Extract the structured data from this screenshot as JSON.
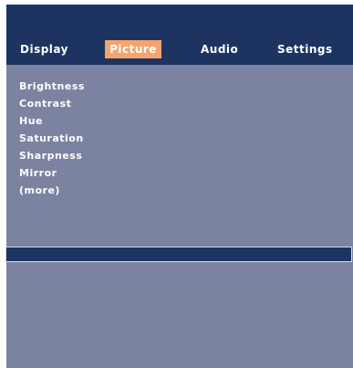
{
  "tabs": {
    "display": "Display",
    "picture": "Picture",
    "audio": "Audio",
    "settings": "Settings"
  },
  "selected_tab": "Picture",
  "picture_menu": {
    "items": [
      "Brightness",
      "Contrast",
      "Hue",
      "Saturation",
      "Sharpness",
      "Mirror",
      "(more)"
    ]
  },
  "colors": {
    "background": "#7b83a1",
    "menu_bar": "#1d3461",
    "selected_tab": "#f4a46c",
    "text": "#ffffff",
    "value_bar": "#1d3461"
  }
}
